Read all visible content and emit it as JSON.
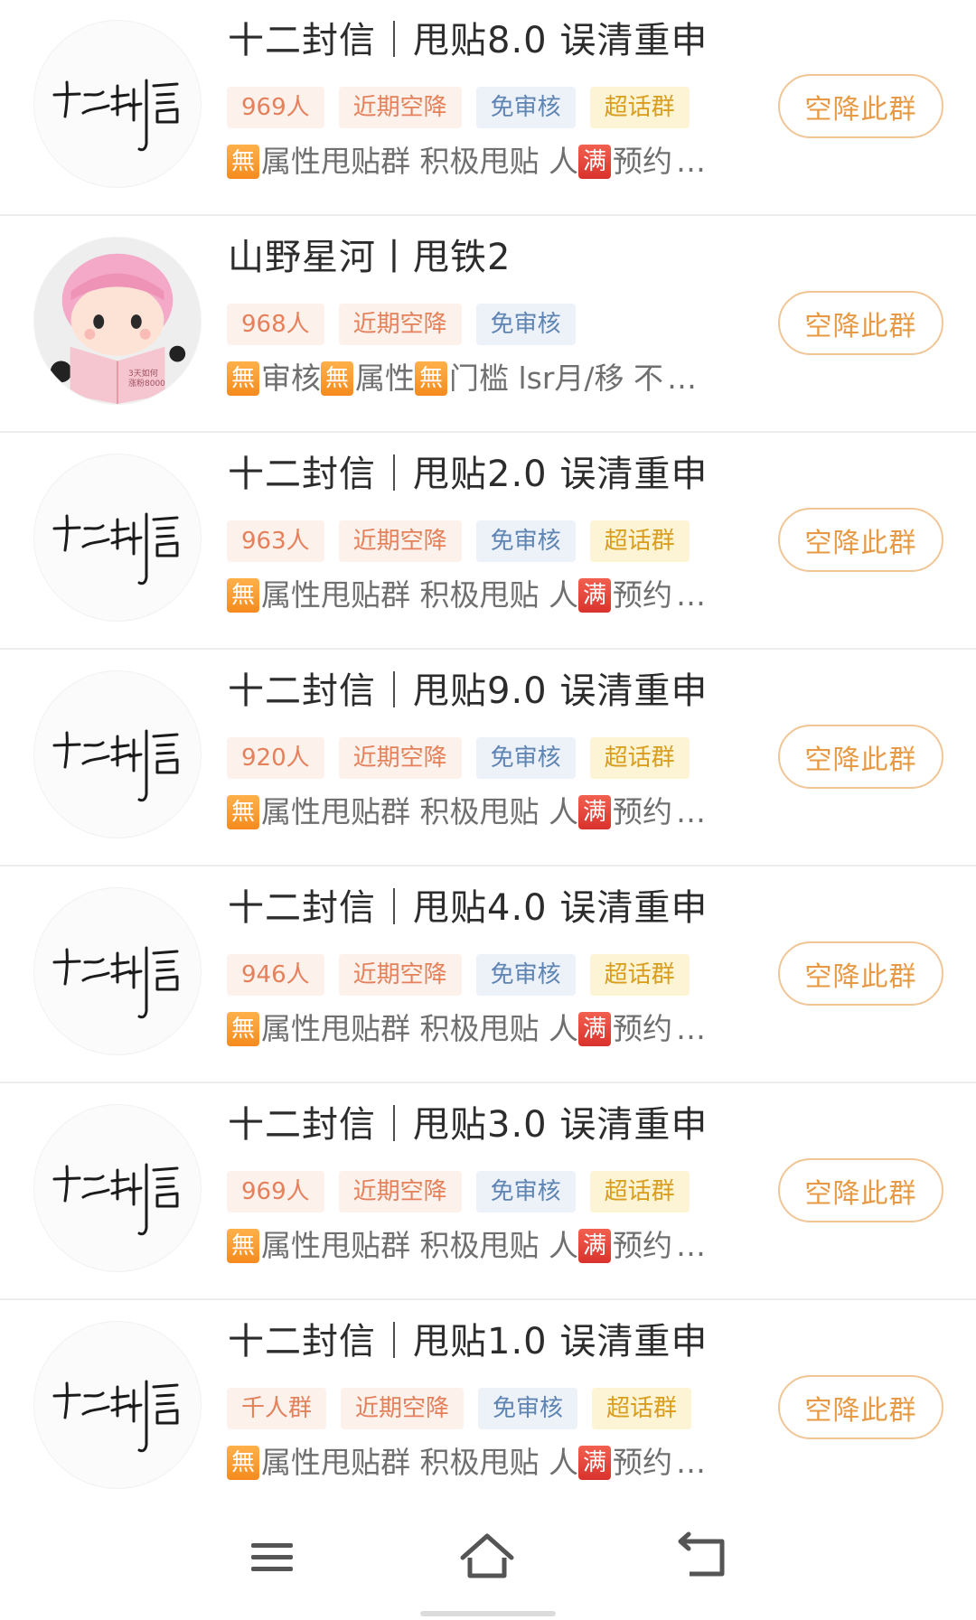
{
  "groups": [
    {
      "title": "十二封信｜甩贴8.0 误清重申",
      "avatar": "calligraphy",
      "avatar_text": "十二封信",
      "tags": [
        {
          "label": "969人",
          "kind": "size"
        },
        {
          "label": "近期空降",
          "kind": "recent"
        },
        {
          "label": "免审核",
          "kind": "free"
        },
        {
          "label": "超话群",
          "kind": "super"
        }
      ],
      "desc": [
        {
          "badge": "無",
          "kind": "none",
          "text": "属性甩贴群 积极甩贴 人"
        },
        {
          "badge": "满",
          "kind": "full",
          "text": "预约"
        }
      ],
      "ellipsis": "…",
      "button": "空降此群"
    },
    {
      "title": "山野星河丨甩铁2",
      "avatar": "doll",
      "avatar_text": "3天如何\n涨粉8000",
      "tags": [
        {
          "label": "968人",
          "kind": "size"
        },
        {
          "label": "近期空降",
          "kind": "recent"
        },
        {
          "label": "免审核",
          "kind": "free"
        }
      ],
      "desc": [
        {
          "badge": "無",
          "kind": "none",
          "text": "审核 "
        },
        {
          "badge": "無",
          "kind": "none",
          "text": "属性 "
        },
        {
          "badge": "無",
          "kind": "none",
          "text": "门槛 lsr月/移 不"
        }
      ],
      "ellipsis": "…",
      "button": "空降此群"
    },
    {
      "title": "十二封信｜甩贴2.0 误清重申",
      "avatar": "calligraphy",
      "avatar_text": "十二封信",
      "tags": [
        {
          "label": "963人",
          "kind": "size"
        },
        {
          "label": "近期空降",
          "kind": "recent"
        },
        {
          "label": "免审核",
          "kind": "free"
        },
        {
          "label": "超话群",
          "kind": "super"
        }
      ],
      "desc": [
        {
          "badge": "無",
          "kind": "none",
          "text": "属性甩贴群 积极甩贴 人"
        },
        {
          "badge": "满",
          "kind": "full",
          "text": "预约"
        }
      ],
      "ellipsis": "…",
      "button": "空降此群"
    },
    {
      "title": "十二封信｜甩贴9.0 误清重申",
      "avatar": "calligraphy",
      "avatar_text": "十二封信",
      "tags": [
        {
          "label": "920人",
          "kind": "size"
        },
        {
          "label": "近期空降",
          "kind": "recent"
        },
        {
          "label": "免审核",
          "kind": "free"
        },
        {
          "label": "超话群",
          "kind": "super"
        }
      ],
      "desc": [
        {
          "badge": "無",
          "kind": "none",
          "text": "属性甩贴群 积极甩贴 人"
        },
        {
          "badge": "满",
          "kind": "full",
          "text": "预约"
        }
      ],
      "ellipsis": "…",
      "button": "空降此群"
    },
    {
      "title": "十二封信｜甩贴4.0 误清重申",
      "avatar": "calligraphy",
      "avatar_text": "十二封信",
      "tags": [
        {
          "label": "946人",
          "kind": "size"
        },
        {
          "label": "近期空降",
          "kind": "recent"
        },
        {
          "label": "免审核",
          "kind": "free"
        },
        {
          "label": "超话群",
          "kind": "super"
        }
      ],
      "desc": [
        {
          "badge": "無",
          "kind": "none",
          "text": "属性甩贴群 积极甩贴 人"
        },
        {
          "badge": "满",
          "kind": "full",
          "text": "预约"
        }
      ],
      "ellipsis": "…",
      "button": "空降此群"
    },
    {
      "title": "十二封信｜甩贴3.0 误清重申",
      "avatar": "calligraphy",
      "avatar_text": "十二封信",
      "tags": [
        {
          "label": "969人",
          "kind": "size"
        },
        {
          "label": "近期空降",
          "kind": "recent"
        },
        {
          "label": "免审核",
          "kind": "free"
        },
        {
          "label": "超话群",
          "kind": "super"
        }
      ],
      "desc": [
        {
          "badge": "無",
          "kind": "none",
          "text": "属性甩贴群 积极甩贴 人"
        },
        {
          "badge": "满",
          "kind": "full",
          "text": "预约"
        }
      ],
      "ellipsis": "…",
      "button": "空降此群"
    },
    {
      "title": "十二封信｜甩贴1.0 误清重申",
      "avatar": "calligraphy",
      "avatar_text": "十二封信",
      "tags": [
        {
          "label": "千人群",
          "kind": "size"
        },
        {
          "label": "近期空降",
          "kind": "recent"
        },
        {
          "label": "免审核",
          "kind": "free"
        },
        {
          "label": "超话群",
          "kind": "super"
        }
      ],
      "desc": [
        {
          "badge": "無",
          "kind": "none",
          "text": "属性甩贴群 积极甩贴 人"
        },
        {
          "badge": "满",
          "kind": "full",
          "text": "预约"
        }
      ],
      "ellipsis": "…",
      "button": "空降此群"
    }
  ],
  "navbar": {
    "items": [
      {
        "icon": "menu-icon"
      },
      {
        "icon": "home-icon"
      },
      {
        "icon": "back-icon"
      }
    ]
  },
  "colors": {
    "button_text": "#e79a45",
    "button_border": "#f1c596",
    "badge_none": "#f68b1d",
    "badge_full": "#d9322d"
  }
}
